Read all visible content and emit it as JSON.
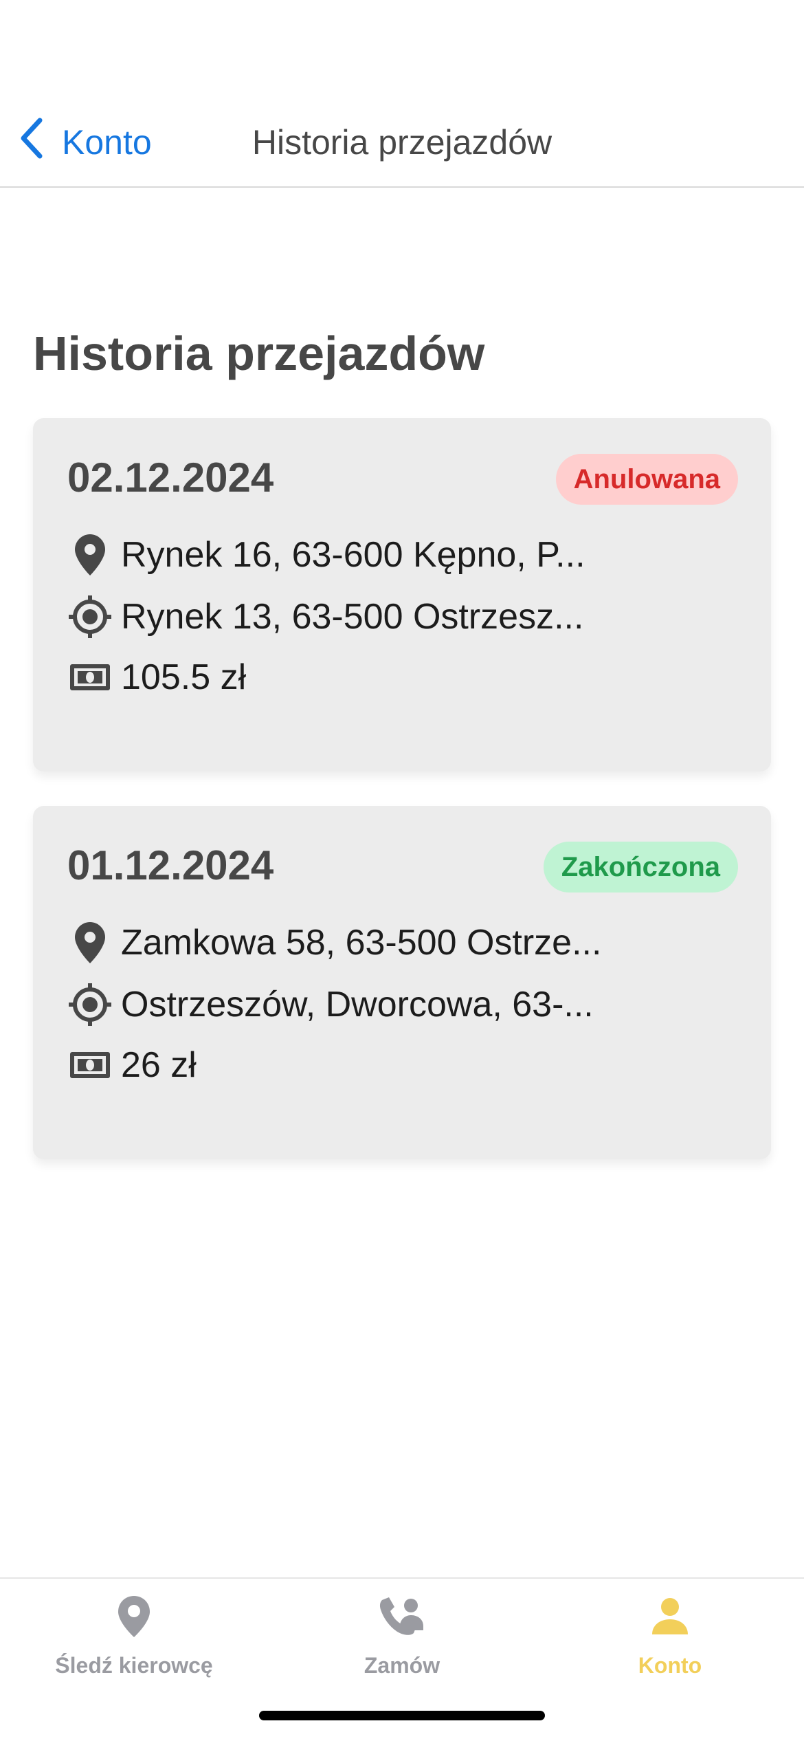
{
  "header": {
    "back_label": "Konto",
    "title": "Historia przejazdów"
  },
  "main": {
    "heading": "Historia przejazdów",
    "rides": [
      {
        "date": "02.12.2024",
        "status": "Anulowana",
        "status_color": "#d72a2a",
        "pickup": "Rynek 16, 63-600 Kępno, P...",
        "destination": "Rynek 13, 63-500 Ostrzesz...",
        "price": "105.5 zł"
      },
      {
        "date": "01.12.2024",
        "status": "Zakończona",
        "status_color": "#1f9a4b",
        "pickup": "Zamkowa 58, 63-500 Ostrze...",
        "destination": "Ostrzeszów, Dworcowa, 63-...",
        "price": "26 zł"
      }
    ]
  },
  "tabbar": {
    "tabs": [
      {
        "label": "Śledź kierowcę",
        "icon": "location-pin-icon"
      },
      {
        "label": "Zamów",
        "icon": "phone-person-icon"
      },
      {
        "label": "Konto",
        "icon": "person-icon",
        "active": true
      }
    ],
    "active_color": "#f2cf5a",
    "inactive_color": "#9a9ba1"
  },
  "colors": {
    "accent": "#1677e0",
    "text": "#474747",
    "card_bg": "#ececec"
  }
}
